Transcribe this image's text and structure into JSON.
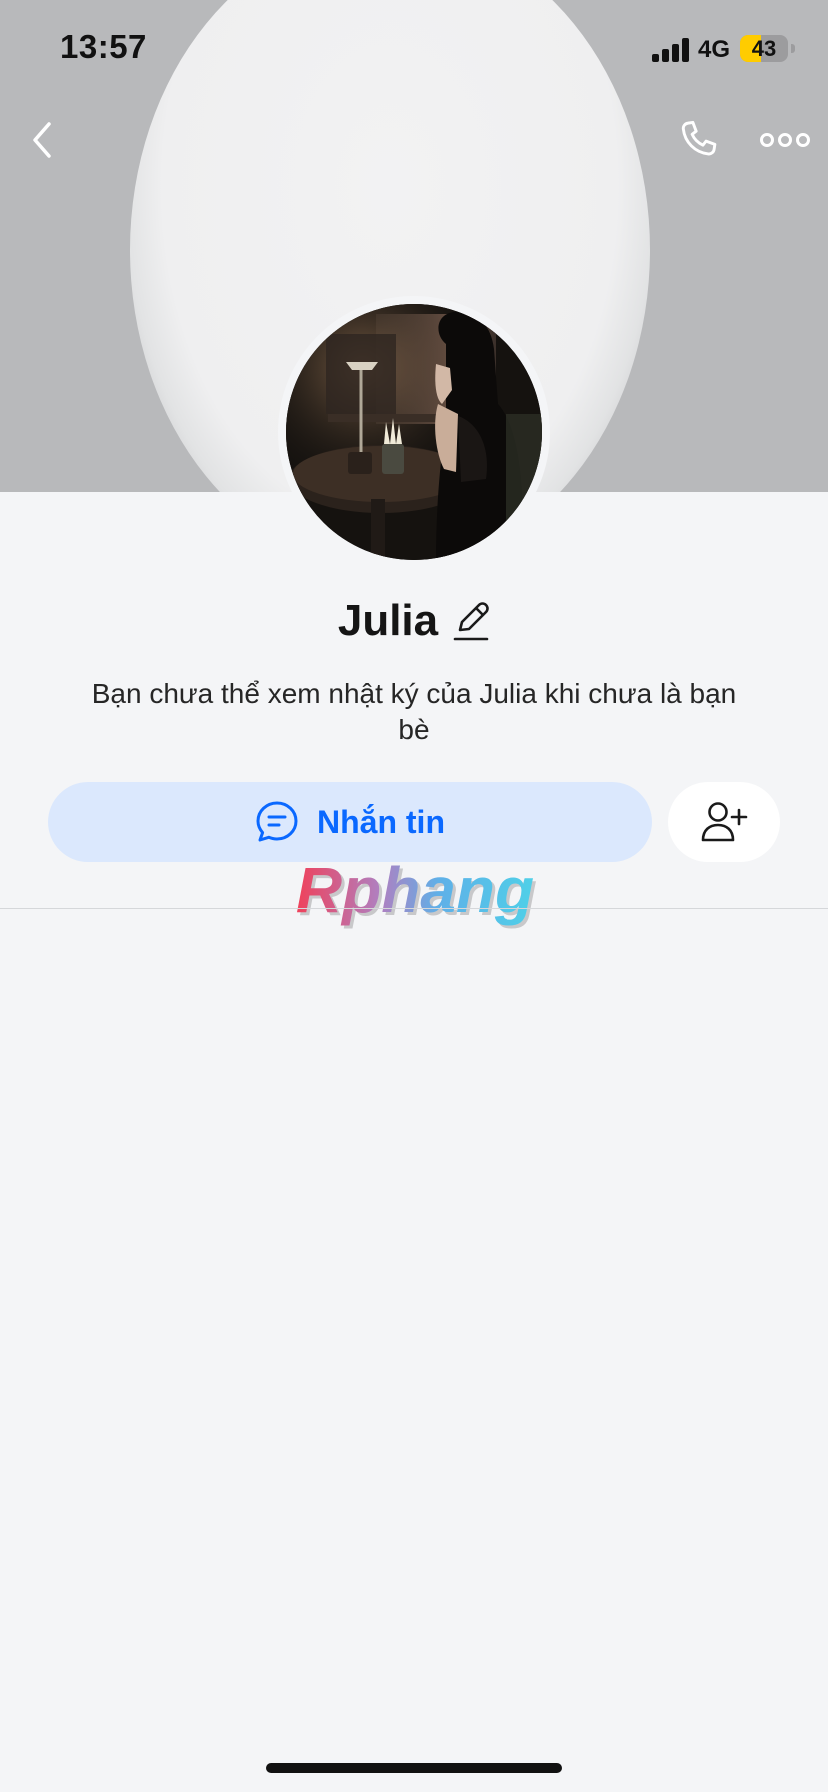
{
  "status_bar": {
    "time": "13:57",
    "network": "4G",
    "battery_percent": "43",
    "battery_level": 0.43,
    "signal_icon": "signal-bars-icon"
  },
  "header": {
    "back_icon": "chevron-left-icon",
    "call_icon": "phone-icon",
    "more_icon": "more-horizontal-icon"
  },
  "profile": {
    "name": "Julia",
    "edit_icon": "pencil-icon",
    "privacy_notice": "Bạn chưa thể xem nhật ký của Julia khi chưa là bạn bè"
  },
  "actions": {
    "message_label": "Nhắn tin",
    "message_icon": "chat-bubble-icon",
    "add_friend_icon": "add-user-icon"
  },
  "watermark": {
    "text": "Rphang"
  },
  "colors": {
    "accent": "#0a68ff",
    "message_button_bg": "#dbe8fd",
    "page_bg": "#f4f5f7",
    "cover_bg": "#b8b9bb",
    "battery": "#ffcc00"
  }
}
